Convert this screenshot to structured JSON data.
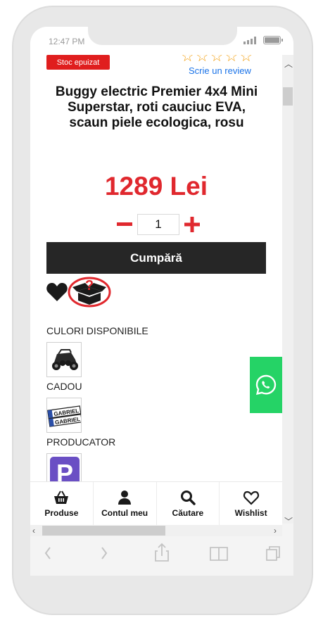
{
  "status_bar": {
    "time": "12:47 PM"
  },
  "product": {
    "stock_badge": "Stoc epuizat",
    "review_link": "Scrie un review",
    "title": "Buggy electric Premier 4x4 Mini Superstar, roti cauciuc EVA, scaun piele ecologica, rosu",
    "price": "1289 Lei",
    "quantity": "1",
    "buy_button": "Cumpără",
    "rating_stars": 0,
    "rating_max": 5
  },
  "sections": {
    "colors_label": "CULORI DISPONIBILE",
    "gift_label": "CADOU",
    "gift_thumb_text_1": "GABRIEL",
    "gift_thumb_text_2": "GABRIEL",
    "producer_label": "PRODUCATOR",
    "producer_logo_text": "P"
  },
  "bottom_nav": {
    "items": [
      {
        "label": "Produse",
        "icon": "basket-icon"
      },
      {
        "label": "Contul meu",
        "icon": "user-icon"
      },
      {
        "label": "Căutare",
        "icon": "search-icon"
      },
      {
        "label": "Wishlist",
        "icon": "heart-outline-icon"
      }
    ]
  },
  "colors": {
    "price_red": "#e0282e",
    "badge_red": "#e01e1e",
    "star_orange": "#f3a31a",
    "link_blue": "#1a73e8",
    "buy_button_bg": "#262626",
    "whatsapp_green": "#25d366"
  }
}
